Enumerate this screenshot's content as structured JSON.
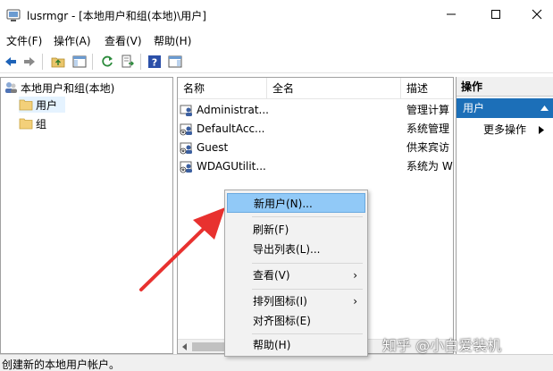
{
  "window": {
    "title": "lusrmgr - [本地用户和组(本地)\\用户]",
    "minimize_icon": "minimize-icon",
    "maximize_icon": "maximize-icon",
    "close_icon": "close-icon"
  },
  "menubar": [
    "文件(F)",
    "操作(A)",
    "查看(V)",
    "帮助(H)"
  ],
  "toolbar": {
    "icons": [
      "back-arrow-icon",
      "forward-arrow-icon",
      "up-folder-icon",
      "show-pane-icon",
      "refresh-icon",
      "export-list-icon",
      "help-icon",
      "action-pane-icon"
    ]
  },
  "tree": {
    "root": "本地用户和组(本地)",
    "items": [
      "用户",
      "组"
    ],
    "selected": "用户"
  },
  "list": {
    "columns": [
      "名称",
      "全名",
      "描述"
    ],
    "rows": [
      {
        "name": "Administrat...",
        "fullname": "",
        "description": "管理计算"
      },
      {
        "name": "DefaultAcc...",
        "fullname": "",
        "description": "系统管理"
      },
      {
        "name": "Guest",
        "fullname": "",
        "description": "供来宾访"
      },
      {
        "name": "WDAGUtilit...",
        "fullname": "",
        "description": "系统为 W"
      }
    ]
  },
  "actions": {
    "header": "操作",
    "section": "用户",
    "more": "更多操作"
  },
  "context_menu": {
    "items": [
      {
        "label": "新用户(N)...",
        "highlighted": true,
        "submenu": false
      },
      {
        "label": "刷新(F)",
        "highlighted": false,
        "submenu": false
      },
      {
        "label": "导出列表(L)...",
        "highlighted": false,
        "submenu": false
      },
      {
        "label": "查看(V)",
        "highlighted": false,
        "submenu": true
      },
      {
        "label": "排列图标(I)",
        "highlighted": false,
        "submenu": true
      },
      {
        "label": "对齐图标(E)",
        "highlighted": false,
        "submenu": false
      },
      {
        "label": "帮助(H)",
        "highlighted": false,
        "submenu": false
      }
    ]
  },
  "status": {
    "text": "创建新的本地用户帐户。"
  },
  "watermark": "知乎 @小白爱装机",
  "colors": {
    "accent": "#1c6fb8",
    "menu_highlight": "#91c9f7",
    "annotation_arrow": "#e8312f"
  }
}
